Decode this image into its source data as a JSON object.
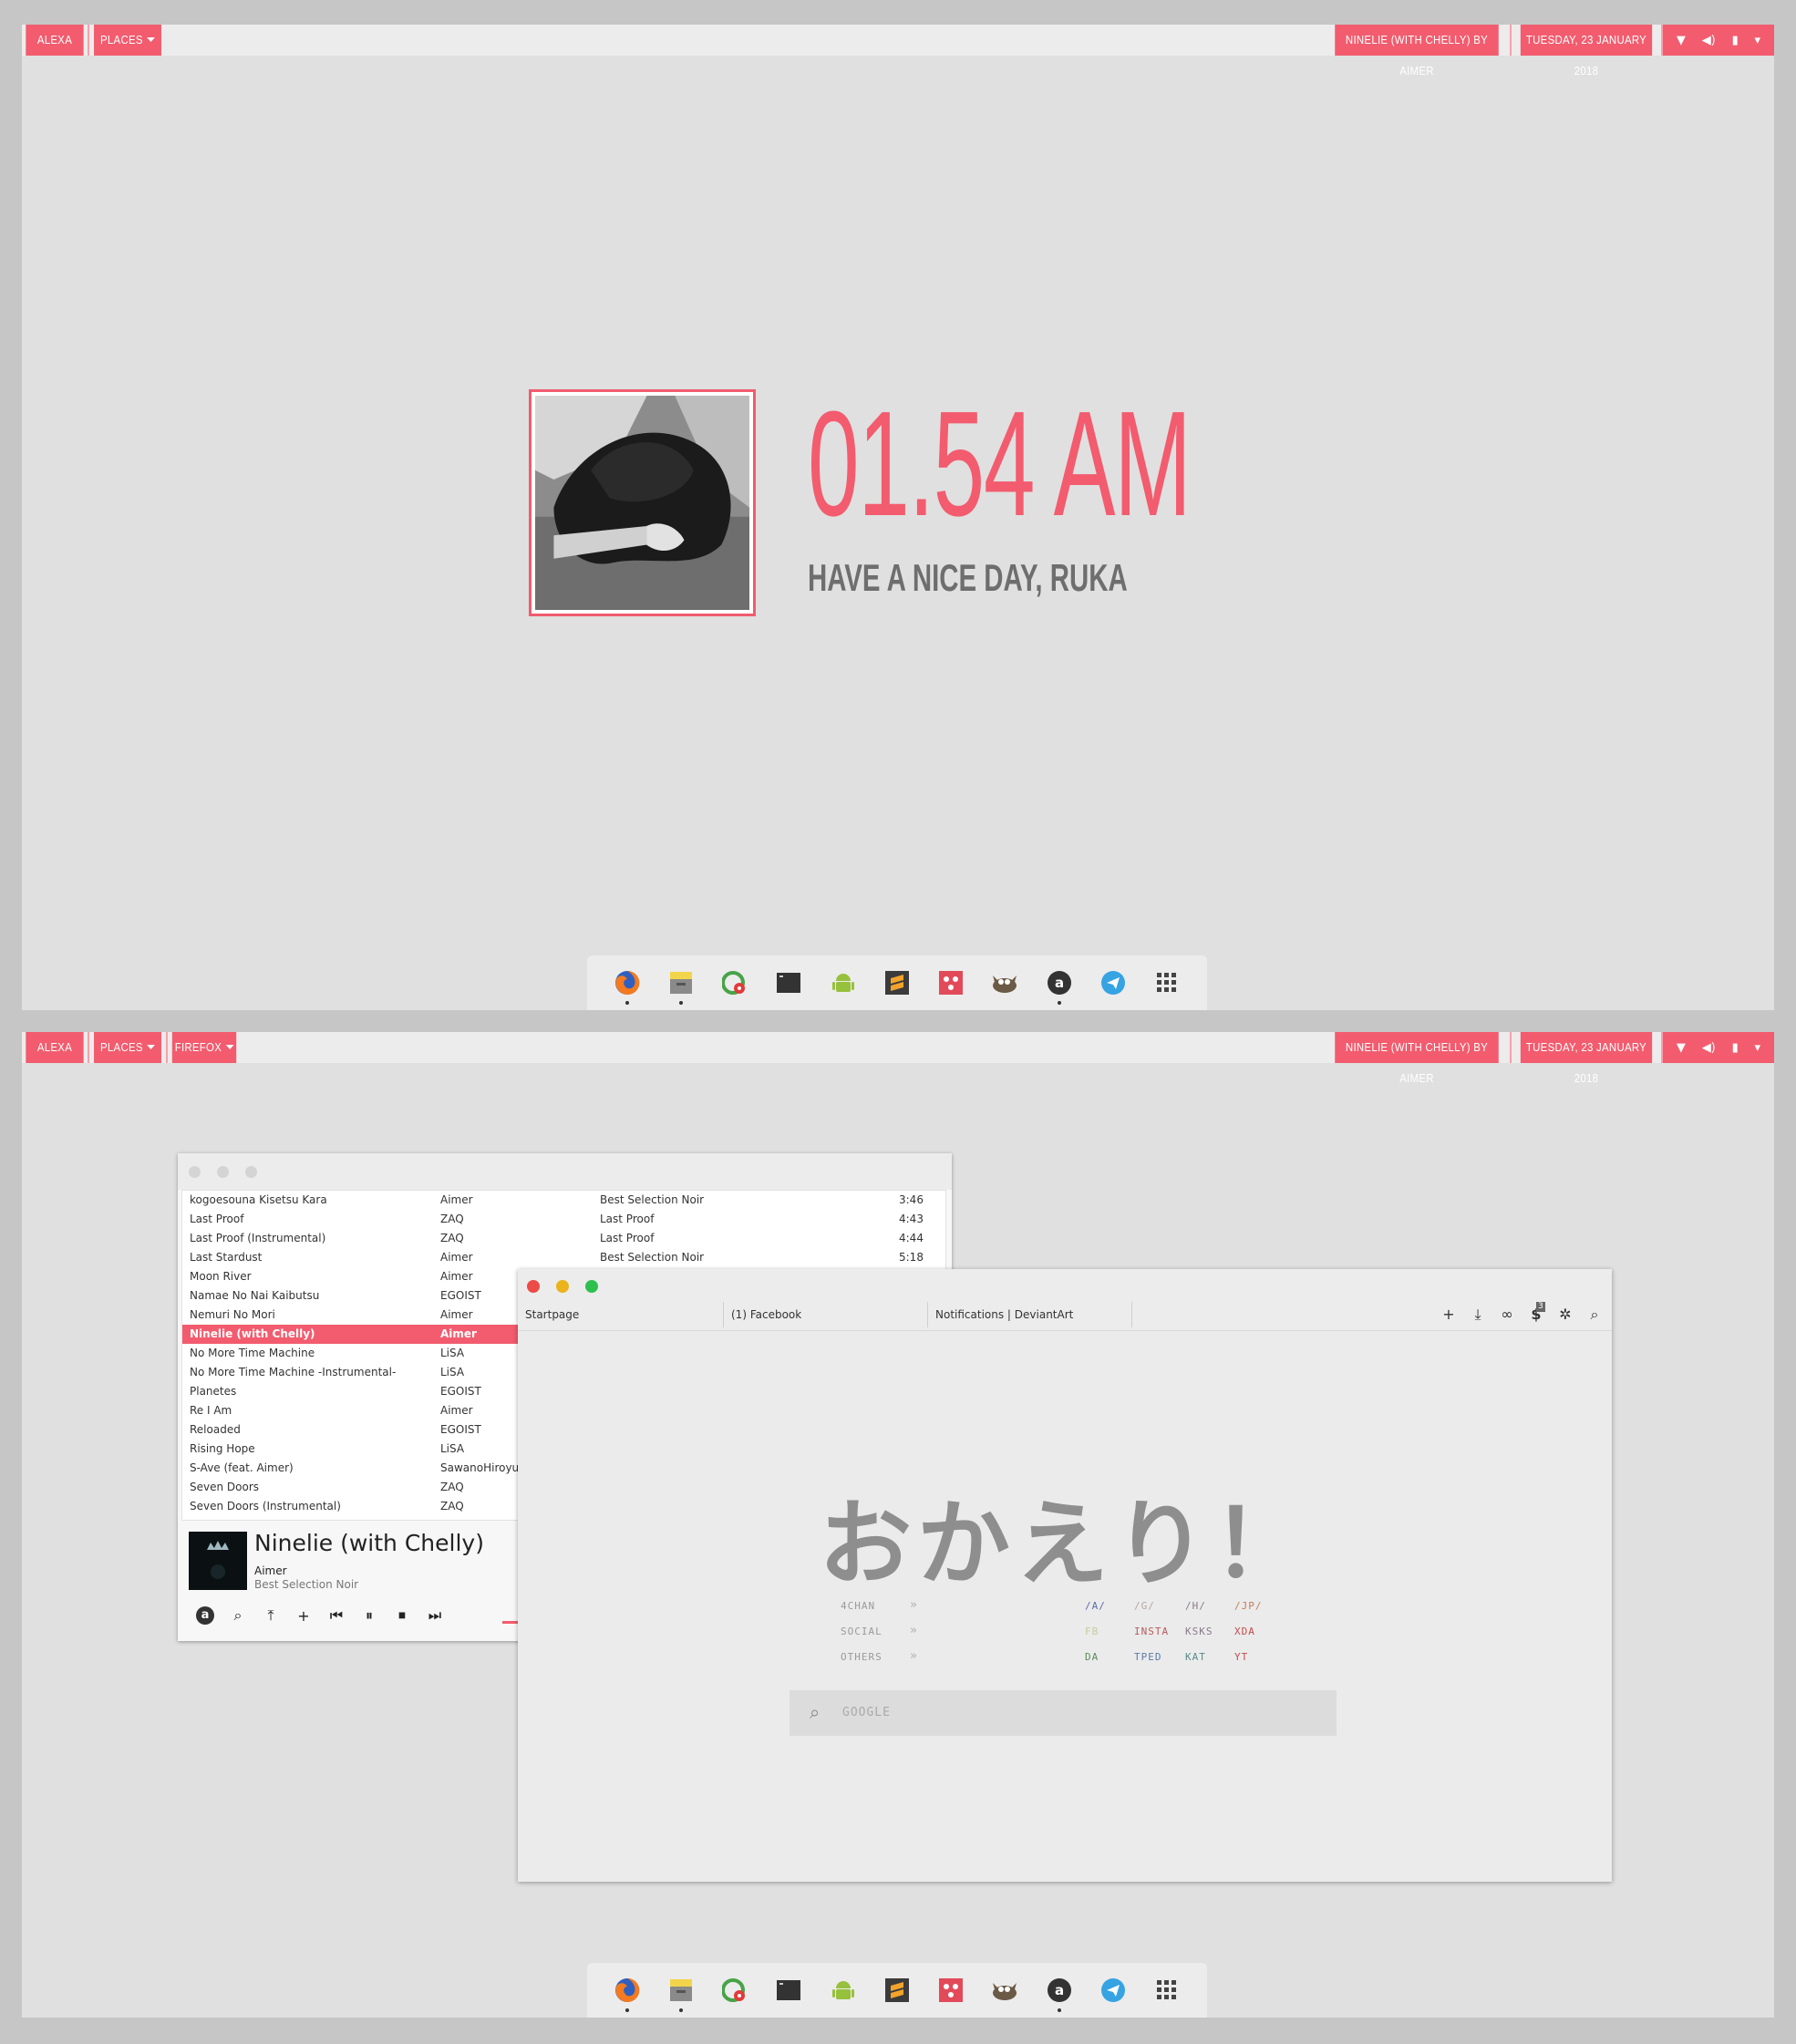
{
  "topbar": {
    "user": "ALEXA",
    "places": "PLACES",
    "firefox": "FIREFOX",
    "now_playing": "NINELIE (WITH CHELLY) BY AIMER",
    "date": "TUESDAY, 23 JANUARY 2018",
    "tray_icons": [
      "wifi-icon",
      "volume-icon",
      "battery-icon",
      "chevron-down-icon"
    ]
  },
  "lockscreen": {
    "time": "01.54 AM",
    "greeting": "HAVE A NICE DAY, RUKA"
  },
  "dock": {
    "apps": [
      "firefox",
      "files",
      "gimp",
      "terminal",
      "android",
      "sublime-text",
      "dots",
      "gimp-wilber",
      "amarok",
      "telegram",
      "app-grid"
    ]
  },
  "music": {
    "tracks": [
      {
        "title": "kogoesouna Kisetsu Kara",
        "artist": "Aimer",
        "album": "Best Selection Noir",
        "length": "3:46"
      },
      {
        "title": "Last Proof",
        "artist": "ZAQ",
        "album": "Last Proof",
        "length": "4:43"
      },
      {
        "title": "Last Proof (Instrumental)",
        "artist": "ZAQ",
        "album": "Last Proof",
        "length": "4:44"
      },
      {
        "title": "Last Stardust",
        "artist": "Aimer",
        "album": "Best Selection Noir",
        "length": "5:18"
      },
      {
        "title": "Moon River",
        "artist": "Aimer",
        "album": "",
        "length": ""
      },
      {
        "title": "Namae No Nai Kaibutsu",
        "artist": "EGOIST",
        "album": "",
        "length": ""
      },
      {
        "title": "Nemuri No Mori",
        "artist": "Aimer",
        "album": "",
        "length": ""
      },
      {
        "title": "Ninelie (with Chelly)",
        "artist": "Aimer",
        "album": "",
        "length": ""
      },
      {
        "title": "No More Time Machine",
        "artist": "LiSA",
        "album": "",
        "length": ""
      },
      {
        "title": "No More Time Machine -Instrumental-",
        "artist": "LiSA",
        "album": "",
        "length": ""
      },
      {
        "title": "Planetes",
        "artist": "EGOIST",
        "album": "",
        "length": ""
      },
      {
        "title": "Re I Am",
        "artist": "Aimer",
        "album": "",
        "length": ""
      },
      {
        "title": "Reloaded",
        "artist": "EGOIST",
        "album": "",
        "length": ""
      },
      {
        "title": "Rising Hope",
        "artist": "LiSA",
        "album": "",
        "length": ""
      },
      {
        "title": "S-Ave (feat. Aimer)",
        "artist": "SawanoHiroyu",
        "album": "",
        "length": ""
      },
      {
        "title": "Seven Doors",
        "artist": "ZAQ",
        "album": "",
        "length": ""
      },
      {
        "title": "Seven Doors (Instrumental)",
        "artist": "ZAQ",
        "album": "",
        "length": ""
      }
    ],
    "selected_index": 7,
    "now_playing": {
      "title": "Ninelie (with Chelly)",
      "artist": "Aimer",
      "album": "Best Selection Noir"
    },
    "controls": [
      "amarok-icon",
      "search-icon",
      "upload-icon",
      "add-icon",
      "previous-icon",
      "pause-icon",
      "stop-icon",
      "next-icon"
    ],
    "control_glyphs": [
      "a",
      "⌕",
      "⤒",
      "+",
      "⏮",
      "⏸",
      "⏹",
      "⏭"
    ]
  },
  "browser": {
    "tabs": [
      "Startpage",
      "(1) Facebook",
      "Notifications | DeviantArt"
    ],
    "toolbar_glyphs": [
      "+",
      "⤓",
      "∞",
      "$",
      "✲",
      "⌕"
    ],
    "toolbar_badge": "3",
    "welcome": "おかえり！",
    "link_groups": [
      "4CHAN",
      "SOCIAL",
      "OTHERS"
    ],
    "arrow": "»",
    "links": [
      [
        "/A/",
        "/G/",
        "/H/",
        "/JP/"
      ],
      [
        "FB",
        "INSTA",
        "KSKS",
        "XDA"
      ],
      [
        "DA",
        "TPED",
        "KAT",
        "YT"
      ]
    ],
    "link_colors": [
      [
        "#5b6ea8",
        "#b6a6a6",
        "#8a7a8a",
        "#c77b5b"
      ],
      [
        "#c9c9a0",
        "#b85b5b",
        "#8a7a8a",
        "#c24b4b"
      ],
      [
        "#5b8a5b",
        "#5b7aa8",
        "#5b8a8a",
        "#c24b4b"
      ]
    ],
    "search_placeholder": "GOOGLE"
  },
  "colors": {
    "accent": "#f25c6e",
    "mac_red": "#ec4b48",
    "mac_yellow": "#eab31b",
    "mac_green": "#2fbf4f"
  }
}
